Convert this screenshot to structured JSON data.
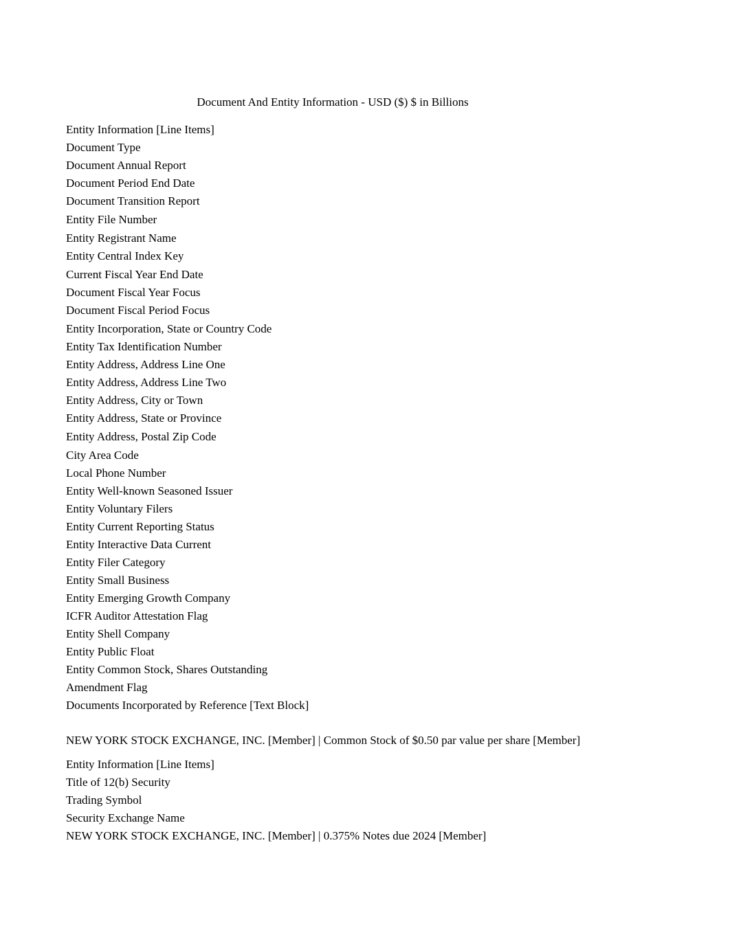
{
  "document": {
    "title": "Document And Entity Information - USD ($) $ in Billions",
    "currency_code": "USD",
    "currency_symbol": "$",
    "scale": "$ in Billions"
  },
  "sections": [
    {
      "id": "entity-information",
      "header": null,
      "rows": [
        {
          "label": "Entity Information [Line Items]"
        },
        {
          "label": "Document Type"
        },
        {
          "label": "Document Annual Report"
        },
        {
          "label": "Document Period End Date"
        },
        {
          "label": "Document Transition Report"
        },
        {
          "label": "Entity File Number"
        },
        {
          "label": "Entity Registrant Name"
        },
        {
          "label": "Entity Central Index Key"
        },
        {
          "label": "Current Fiscal Year End Date"
        },
        {
          "label": "Document Fiscal Year Focus"
        },
        {
          "label": "Document Fiscal Period Focus"
        },
        {
          "label": "Entity Incorporation, State or Country Code"
        },
        {
          "label": "Entity Tax Identification Number"
        },
        {
          "label": "Entity Address, Address Line One"
        },
        {
          "label": "Entity Address, Address Line Two"
        },
        {
          "label": "Entity Address, City or Town"
        },
        {
          "label": "Entity Address, State or Province"
        },
        {
          "label": "Entity Address, Postal Zip Code"
        },
        {
          "label": "City Area Code"
        },
        {
          "label": "Local Phone Number"
        },
        {
          "label": "Entity Well-known Seasoned Issuer"
        },
        {
          "label": "Entity Voluntary Filers"
        },
        {
          "label": "Entity Current Reporting Status"
        },
        {
          "label": "Entity Interactive Data Current"
        },
        {
          "label": "Entity Filer Category"
        },
        {
          "label": "Entity Small Business"
        },
        {
          "label": "Entity Emerging Growth Company"
        },
        {
          "label": "ICFR Auditor Attestation Flag"
        },
        {
          "label": "Entity Shell Company"
        },
        {
          "label": "Entity Public Float"
        },
        {
          "label": "Entity Common Stock, Shares Outstanding"
        },
        {
          "label": "Amendment Flag"
        },
        {
          "label": "Documents Incorporated by Reference [Text Block]"
        }
      ]
    },
    {
      "id": "nyse-common-stock",
      "header": "NEW YORK STOCK EXCHANGE, INC. [Member] | Common Stock of $0.50 par value per share [Member]",
      "rows": [
        {
          "label": "Entity Information [Line Items]"
        },
        {
          "label": "Title of 12(b) Security"
        },
        {
          "label": "Trading Symbol"
        },
        {
          "label": "Security Exchange Name"
        }
      ]
    },
    {
      "id": "nyse-notes-2024",
      "header": "NEW YORK STOCK EXCHANGE, INC. [Member] | 0.375% Notes due 2024 [Member]",
      "rows": []
    }
  ]
}
